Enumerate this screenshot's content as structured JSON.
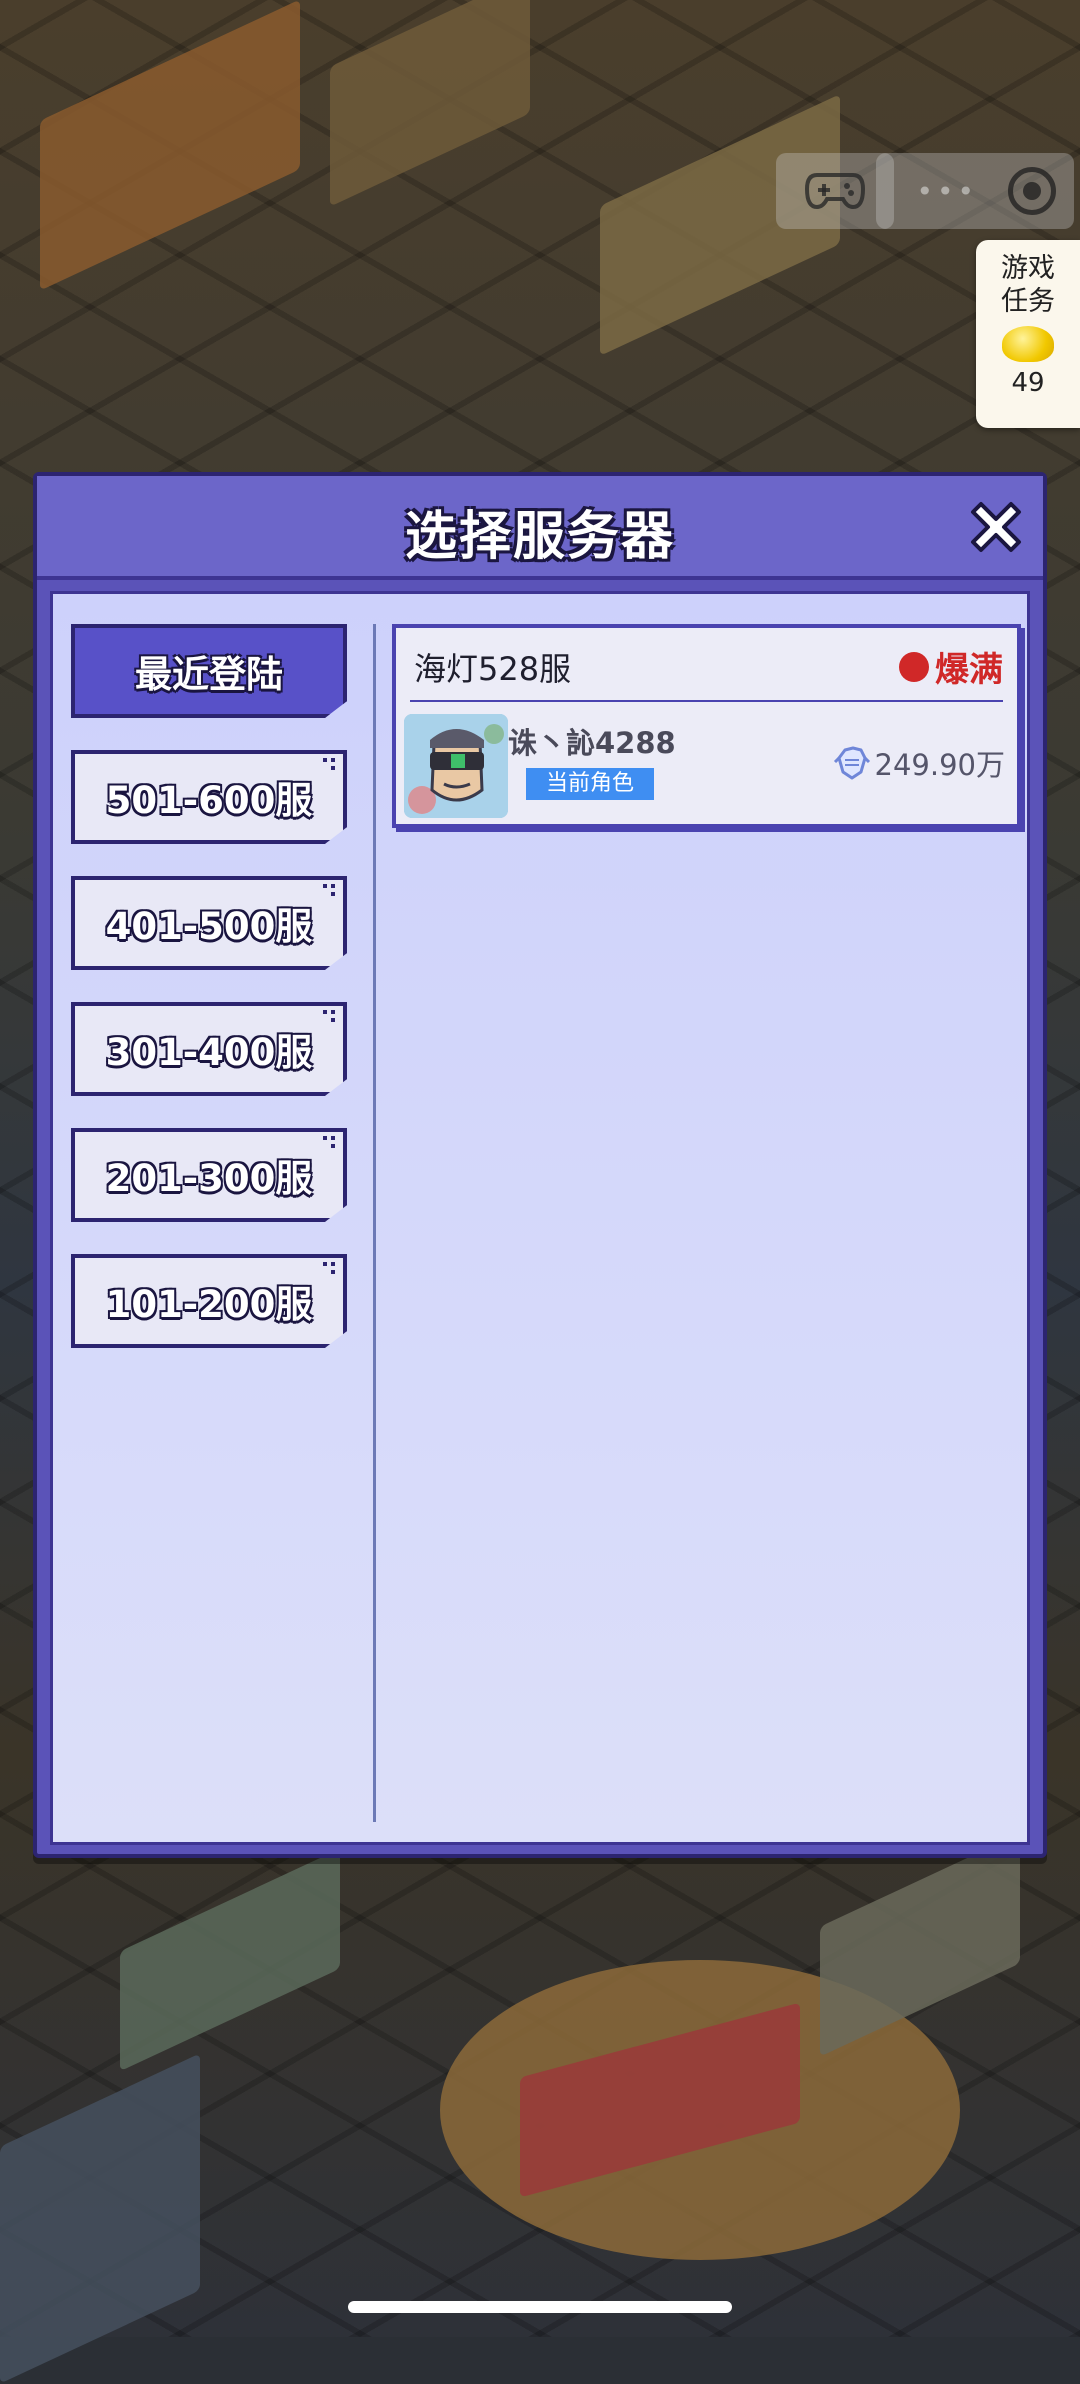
{
  "hud": {
    "gamepad_icon": "gamepad-icon",
    "target_icon": "target-icon",
    "tasks_label": "游戏任务",
    "tasks_count": "49",
    "gold_icon": "gold-ingot-icon"
  },
  "dialog": {
    "title": "选择服务器",
    "close_icon": "close-icon",
    "tabs": [
      {
        "label": "最近登陆",
        "active": true
      },
      {
        "label": "501-600服",
        "active": false
      },
      {
        "label": "401-500服",
        "active": false
      },
      {
        "label": "301-400服",
        "active": false
      },
      {
        "label": "201-300服",
        "active": false
      },
      {
        "label": "101-200服",
        "active": false
      }
    ],
    "server_card": {
      "server_name": "海灯528服",
      "status": "爆满",
      "status_color": "#d02828",
      "character_name": "诛丶訫4288",
      "badge": "当前角色",
      "power": "249.90万",
      "power_icon": "fist-icon"
    }
  },
  "colors": {
    "dialog_frame": "#5b53b8",
    "active_tab": "#5851c8",
    "badge": "#3f8ef2"
  }
}
